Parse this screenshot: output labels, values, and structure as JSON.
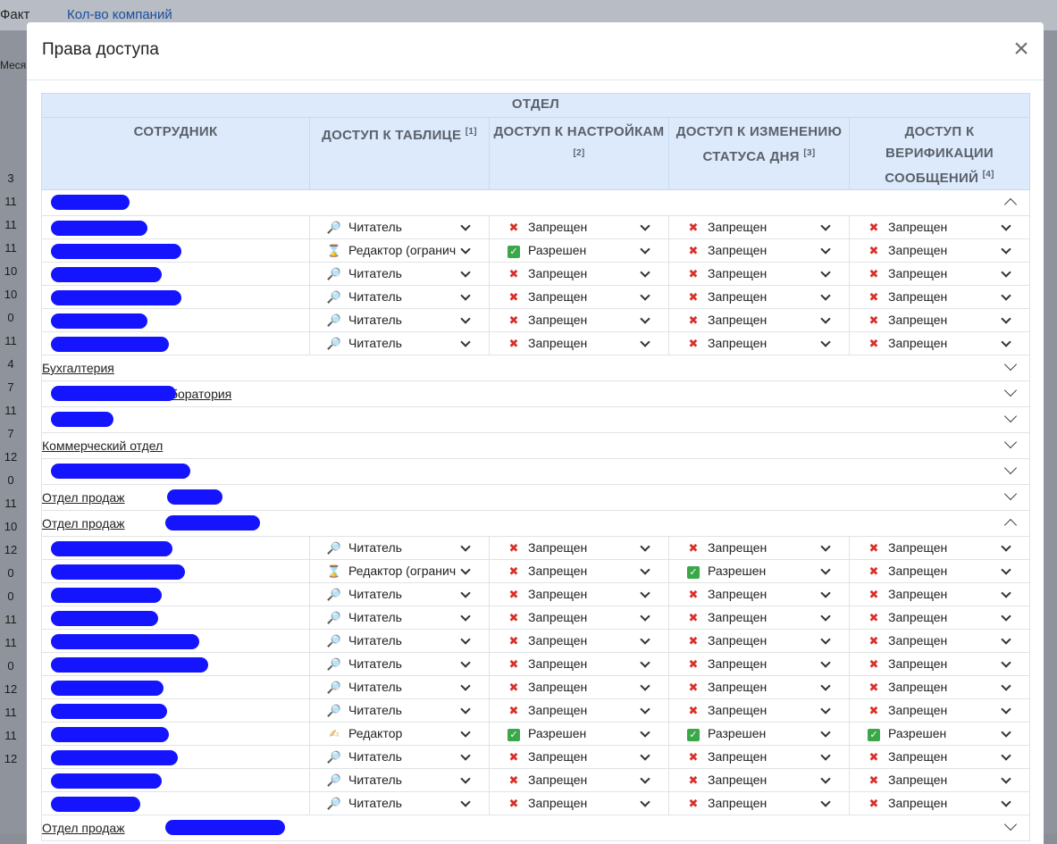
{
  "background": {
    "fact_label": "Факт",
    "companies_link": "Кол-во компаний",
    "month_label": "Меся",
    "left_numbers": [
      "3",
      "11",
      "11",
      "11",
      "10",
      "10",
      "0",
      "11",
      "4",
      "7",
      "11",
      "7",
      "12",
      "0",
      "11",
      "10",
      "12",
      "0",
      "0",
      "11",
      "11",
      "0",
      "12",
      "11",
      "11",
      "12"
    ]
  },
  "modal": {
    "title": "Права доступа",
    "close_icon": "close-icon"
  },
  "table": {
    "group_header": "Отдел",
    "columns": {
      "employee": "Сотрудник",
      "table_access": "Доступ к таблице",
      "table_access_ref": "[1]",
      "settings_access": "Доступ к настройкам",
      "settings_access_ref": "[2]",
      "status_access": "Доступ к изменению статуса дня",
      "status_access_ref": "[3]",
      "verify_access": "Доступ к верификации сообщений",
      "verify_access_ref": "[4]"
    },
    "labels": {
      "reader": "Читатель",
      "editor_limited": "Редактор (огранич",
      "editor": "Редактор",
      "denied": "Запрещен",
      "allowed": "Разрешен"
    },
    "groups": [
      {
        "name": "",
        "expanded": true
      },
      {
        "name": "Бухгалтерия",
        "expanded": false
      },
      {
        "name": "лаборатория",
        "expanded": false
      },
      {
        "name": "",
        "expanded": false
      },
      {
        "name": "Коммерческий отдел",
        "expanded": false
      },
      {
        "name": "",
        "expanded": false
      },
      {
        "name": "Отдел продаж",
        "expanded": false
      },
      {
        "name": "Отдел продаж",
        "expanded": true
      },
      {
        "name": "Отдел продаж",
        "expanded": false
      }
    ]
  },
  "colors": {
    "header_bg": "#dceafc",
    "link": "#1a6fd6",
    "deny": "#d9302a",
    "allow": "#3aa849",
    "redaction": "#1414ff"
  }
}
